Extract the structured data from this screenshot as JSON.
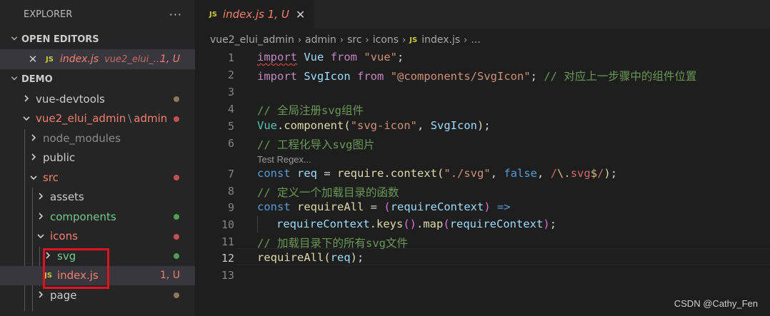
{
  "explorer": {
    "title": "EXPLORER",
    "more": "···",
    "open_editors_header": "OPEN EDITORS",
    "open_editor": {
      "badge": "JS",
      "name": "index.js",
      "path": "vue2_elui_...",
      "status": "1, U"
    },
    "workspace_header": "DEMO",
    "tree": [
      {
        "label": "vue-devtools",
        "dot_color": "#8b7a5a"
      },
      {
        "label": "vue2_elui_admin",
        "suffix": "admin",
        "dot_color": "#c74e4e"
      },
      {
        "label": "node_modules"
      },
      {
        "label": "public"
      },
      {
        "label": "src",
        "dot_color": "#c74e4e"
      },
      {
        "label": "assets"
      },
      {
        "label": "components",
        "dot_color": "#4f9e56"
      },
      {
        "label": "icons",
        "dot_color": "#c74e4e"
      },
      {
        "label": "svg",
        "dot_color": "#4f9e56"
      },
      {
        "label": "index.js",
        "badge": "JS",
        "status": "1, U"
      },
      {
        "label": "page",
        "dot_color": "#8b7a5a"
      }
    ]
  },
  "colors": {
    "untracked": "#73c991",
    "modified": "#e2c08d",
    "error": "#f88070",
    "ignored": "#8c8c8c",
    "default": "#cccccc"
  },
  "editor": {
    "tab": {
      "badge": "JS",
      "label": "index.js 1, U",
      "close": "✕"
    },
    "breadcrumb": [
      "vue2_elui_admin",
      "admin",
      "src",
      "icons",
      "index.js",
      "..."
    ],
    "line_numbers": [
      "1",
      "2",
      "3",
      "4",
      "5",
      "6",
      "7",
      "8",
      "9",
      "10",
      "11",
      "12",
      "13"
    ],
    "active_line": "12",
    "codelens": "Test Regex...",
    "code": {
      "l1": {
        "import": "import",
        "name": "Vue",
        "from": "from",
        "str": "\"vue\"",
        "end": ";"
      },
      "l2": {
        "import": "import",
        "name": "SvgIcon",
        "from": "from",
        "str": "\"@components/SvgIcon\"",
        "end": ";",
        "comment": "// 对应上一步骤中的组件位置"
      },
      "l4": "// 全局注册svg组件",
      "l5": {
        "obj": "Vue",
        "dot": ".",
        "fn": "component",
        "open": "(",
        "str": "\"svg-icon\"",
        "comma": ", ",
        "arg": "SvgIcon",
        "close": ")",
        "end": ";"
      },
      "l6": "// 工程化导入svg图片",
      "l7": {
        "kw": "const",
        "var": "req",
        "eq": " = ",
        "obj": "require",
        "dot": ".",
        "fn": "context",
        "open": "(",
        "str": "\"./svg\"",
        "comma1": ", ",
        "bool": "false",
        "comma2": ", ",
        "rx1": "/",
        "rx2": "\\.",
        "rx3": "svg",
        "rx4": "$",
        "rx5": "/",
        "close": ")",
        "end": ";"
      },
      "l8": "// 定义一个加载目录的函数",
      "l9": {
        "kw": "const",
        "fn": "requireAll",
        "eq": " = ",
        "open": "(",
        "param": "requireContext",
        "close": ")",
        "arrow": " =>"
      },
      "l10": {
        "obj": "requireContext",
        "dot1": ".",
        "fn1": "keys",
        "p1": "()",
        "dot2": ".",
        "fn2": "map",
        "open": "(",
        "arg": "requireContext",
        "close": ")",
        "end": ";"
      },
      "l11": "// 加载目录下的所有svg文件",
      "l12": {
        "fn": "requireAll",
        "open": "(",
        "arg": "req",
        "close": ")",
        "end": ";"
      }
    }
  },
  "watermark": "CSDN @Cathy_Fen"
}
